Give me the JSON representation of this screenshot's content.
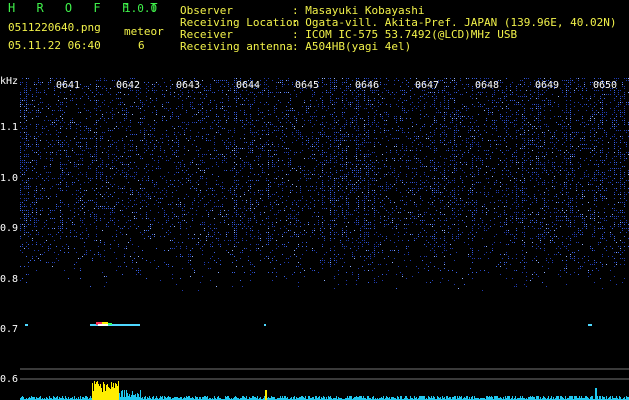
{
  "app": {
    "title": "H R O F F T",
    "version": "1.0.0"
  },
  "file": {
    "name": "0511220640.png",
    "datetime": "05.11.22 06:40"
  },
  "meteor": {
    "label": "meteor",
    "count": "6"
  },
  "info": {
    "labels": [
      "Observer",
      "Receiving Location",
      "Receiver",
      "Receiving antenna"
    ],
    "values": [
      ": Masayuki Kobayashi",
      ": Ogata-vill. Akita-Pref. JAPAN (139.96E, 40.02N)",
      ": ICOM IC-575 53.7492(@LCD)MHz USB",
      ": A504HB(yagi 4el)"
    ]
  },
  "axis": {
    "unit": "kHz",
    "freq_labels": [
      "1.1",
      "1.0",
      "0.9",
      "0.8",
      "0.7",
      "0.6"
    ],
    "time_labels": [
      "0641",
      "0642",
      "0643",
      "0644",
      "0645",
      "0646",
      "0647",
      "0648",
      "0649",
      "0650"
    ]
  },
  "colors": {
    "header_green": "#3ff04a",
    "header_yellow": "#f2f24a",
    "signal_blue": "#2a4fd8",
    "echo_yellow": "#ffee00",
    "echo_cyan": "#20c8f0"
  }
}
